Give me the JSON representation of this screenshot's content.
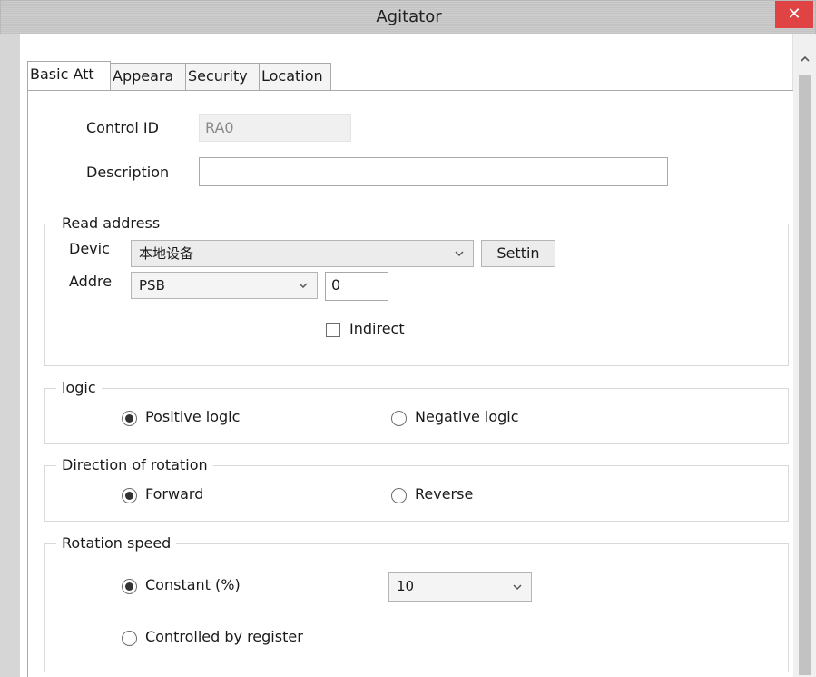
{
  "window": {
    "title": "Agitator",
    "close_glyph": "✕"
  },
  "tabs": [
    {
      "label": "Basic Att",
      "active": true
    },
    {
      "label": "Appeara",
      "active": false
    },
    {
      "label": "Security",
      "active": false
    },
    {
      "label": "Location",
      "active": false
    }
  ],
  "basic": {
    "control_id_label": "Control ID",
    "control_id_value": "RA0",
    "description_label": "Description",
    "description_value": ""
  },
  "read_address": {
    "title": "Read address",
    "device_label": "Devic",
    "device_value": "本地设备",
    "settings_button": "Settin",
    "address_label": "Addre",
    "address_type": "PSB",
    "address_value": "0",
    "indirect_label": "Indirect",
    "indirect_checked": false
  },
  "logic": {
    "title": "logic",
    "options": [
      {
        "label": "Positive logic",
        "checked": true
      },
      {
        "label": "Negative logic",
        "checked": false
      }
    ]
  },
  "direction": {
    "title": "Direction of rotation",
    "options": [
      {
        "label": "Forward",
        "checked": true
      },
      {
        "label": "Reverse",
        "checked": false
      }
    ]
  },
  "speed": {
    "title": "Rotation speed",
    "constant_label": "Constant (%)",
    "constant_checked": true,
    "constant_value": "10",
    "register_label": "Controlled by register",
    "register_checked": false
  },
  "icons": {
    "close": "close-icon",
    "dropdown": "chevron-down-icon",
    "scroll_up": "chevron-up-icon"
  }
}
